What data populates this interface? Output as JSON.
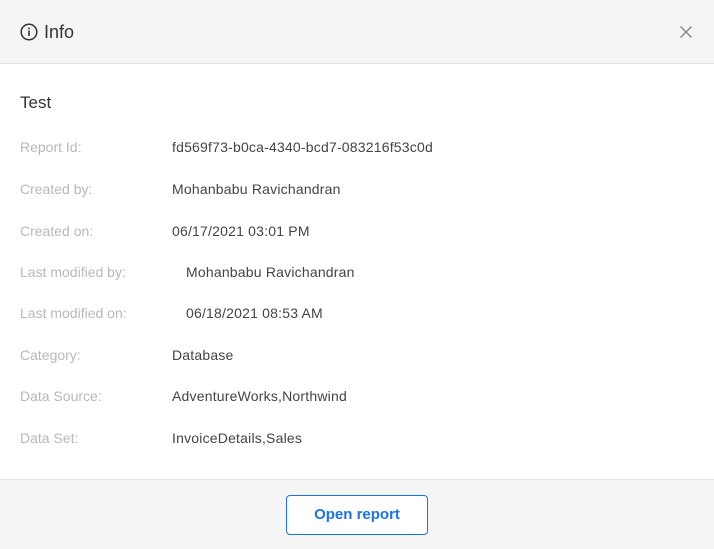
{
  "header": {
    "title": "Info",
    "info_icon": "info-circle-icon",
    "close_icon": "close-icon"
  },
  "report": {
    "name": "Test"
  },
  "details": [
    {
      "label": "Report Id:",
      "value": "fd569f73-b0ca-4340-bcd7-083216f53c0d"
    },
    {
      "label": "Created by:",
      "value": "Mohanbabu Ravichandran"
    },
    {
      "label": "Created on:",
      "value": "06/17/2021 03:01 PM"
    },
    {
      "label": "Last modified by:",
      "value": "Mohanbabu Ravichandran"
    },
    {
      "label": "Last modified on:",
      "value": "06/18/2021 08:53 AM"
    },
    {
      "label": "Category:",
      "value": "Database"
    },
    {
      "label": "Data Source:",
      "value": "AdventureWorks,Northwind"
    },
    {
      "label": "Data Set:",
      "value": "InvoiceDetails,Sales"
    }
  ],
  "footer": {
    "open_label": "Open report"
  },
  "colors": {
    "accent": "#1a73e8",
    "header_bg": "#f5f5f5",
    "label_text": "#b8b8b8",
    "value_text": "#444444"
  }
}
